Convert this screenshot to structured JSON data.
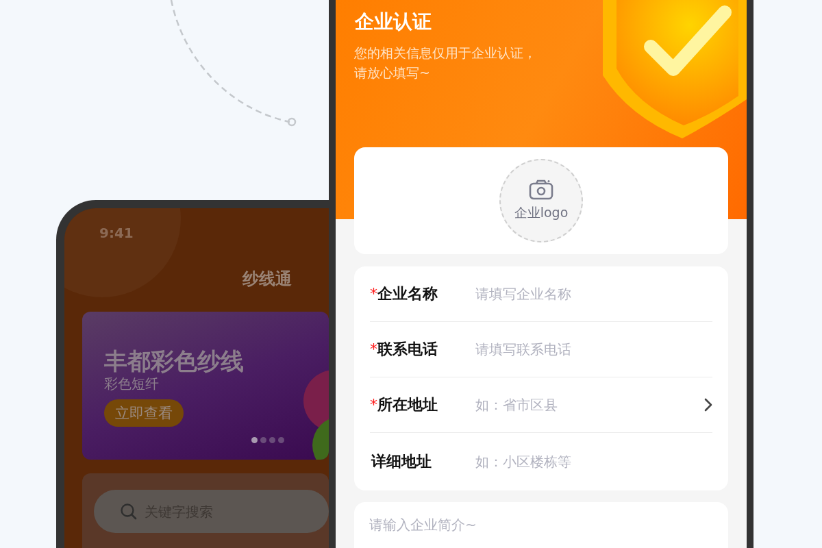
{
  "back_phone": {
    "status_time": "9:41",
    "app_title": "纱线通",
    "banner": {
      "title": "丰都彩色纱线",
      "subtitle": "彩色短纤",
      "button": "立即查看",
      "dots": [
        {
          "selected": true
        },
        {
          "selected": false
        },
        {
          "selected": false
        },
        {
          "selected": false
        }
      ]
    },
    "search": {
      "placeholder": "关键字搜索"
    }
  },
  "front_phone": {
    "title": "企业认证",
    "subtitle_lines": [
      "您的相关信息仅用于企业认证，",
      "请放心填写~"
    ],
    "logo_upload": {
      "label": "企业logo"
    },
    "fields": [
      {
        "kind": "text",
        "marker": "*",
        "label": "企业名称",
        "placeholder": "请填写企业名称"
      },
      {
        "kind": "text",
        "marker": "*",
        "label": "联系电话",
        "placeholder": "请填写联系电话"
      },
      {
        "kind": "select",
        "marker": "*",
        "label": "所在地址",
        "placeholder": "如：省市区县"
      },
      {
        "kind": "text",
        "label": "详细地址",
        "placeholder": "如：小区楼栋等"
      }
    ],
    "intro": {
      "placeholder": "请输入企业简介~"
    }
  }
}
